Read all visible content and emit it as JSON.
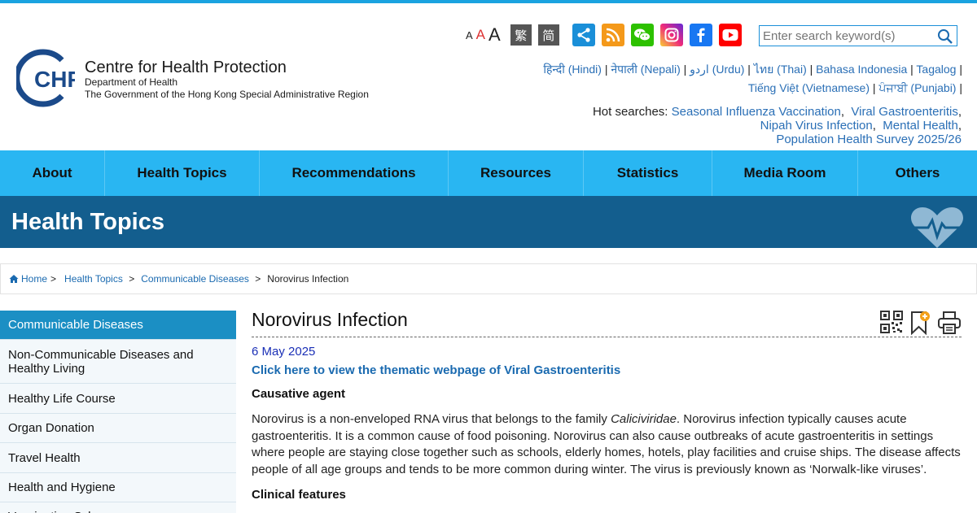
{
  "header": {
    "logo_letters": "CHP",
    "title": "Centre for Health Protection",
    "dept": "Department of Health",
    "gov": "The Government of the Hong Kong Special Administrative Region",
    "font_sizes": [
      "A",
      "A",
      "A"
    ],
    "trad_chinese": "繁",
    "simp_chinese": "简",
    "search_placeholder": "Enter search keyword(s)",
    "languages": [
      "हिन्दी (Hindi)",
      "नेपाली (Nepali)",
      "اردو (Urdu)",
      "ไทย (Thai)",
      "Bahasa Indonesia",
      "Tagalog",
      "Tiếng Việt (Vietnamese)",
      "ਪੰਜਾਬੀ (Punjabi)"
    ],
    "hot_label": "Hot searches:",
    "hot_searches": [
      "Seasonal Influenza Vaccination",
      "Viral Gastroenteritis",
      "Nipah Virus Infection",
      "Mental Health",
      "Population Health Survey 2025/26"
    ],
    "icons": [
      "share-icon",
      "rss-icon",
      "wechat-icon",
      "instagram-icon",
      "facebook-icon",
      "youtube-icon",
      "search-icon"
    ]
  },
  "nav": [
    "About",
    "Health Topics",
    "Recommendations",
    "Resources",
    "Statistics",
    "Media Room",
    "Others"
  ],
  "banner": {
    "title": "Health Topics"
  },
  "breadcrumb": {
    "home": "Home",
    "health_topics": "Health Topics",
    "communicable": "Communicable Diseases",
    "current": "Norovirus Infection"
  },
  "sidebar": [
    "Communicable Diseases",
    "Non-Communicable Diseases and Healthy Living",
    "Healthy Life Course",
    "Organ Donation",
    "Travel Health",
    "Health and Hygiene",
    "Vaccination Schemes"
  ],
  "article": {
    "title": "Norovirus Infection",
    "date": "6 May 2025",
    "thematic_link": "Click here to view the thematic webpage of Viral Gastroenteritis",
    "causative_heading": "Causative agent",
    "causative_pre": "Norovirus is a non-enveloped RNA virus that belongs to the family ",
    "causative_family": "Caliciviridae",
    "causative_post": ". Norovirus infection typically causes acute gastroenteritis. It is a common cause of food poisoning. Norovirus can also cause outbreaks of acute gastroenteritis in settings where people are staying close together such as schools, elderly homes, hotels, play facilities and cruise ships. The disease affects people of all age groups and tends to be more common during winter. The virus is previously known as ‘Norwalk-like viruses’.",
    "clinical_heading": "Clinical features"
  },
  "colors": {
    "nav_bg": "#29b6f2",
    "banner_bg": "#135e8e",
    "sidebar_active": "#1b8fc4",
    "link": "#2a6fb6"
  }
}
